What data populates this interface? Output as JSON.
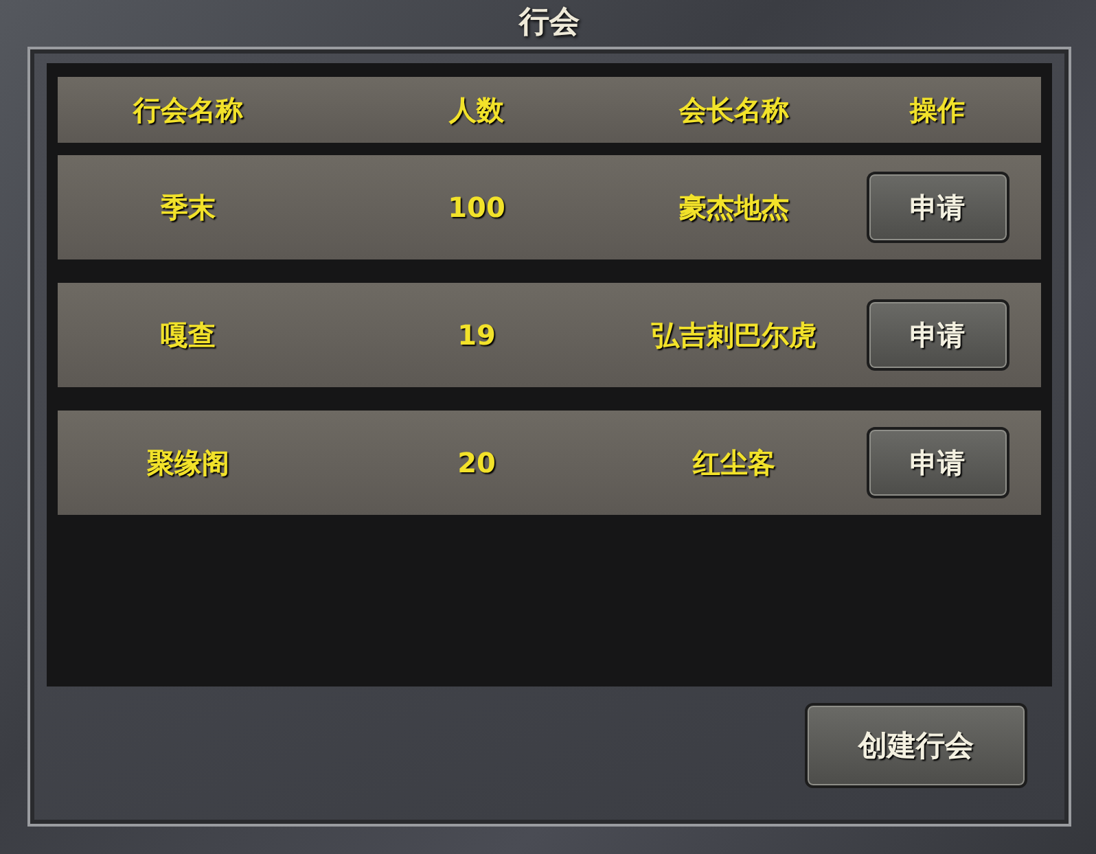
{
  "window": {
    "title": "行会"
  },
  "table": {
    "columns": [
      "行会名称",
      "人数",
      "会长名称",
      "操作"
    ],
    "rows": [
      {
        "name": "季末",
        "members": "100",
        "leader": "豪杰地杰",
        "action": "申请"
      },
      {
        "name": "嘎查",
        "members": "19",
        "leader": "弘吉剌巴尔虎",
        "action": "申请"
      },
      {
        "name": "聚缘阁",
        "members": "20",
        "leader": "红尘客",
        "action": "申请"
      }
    ]
  },
  "buttons": [
    "创建行会"
  ]
}
